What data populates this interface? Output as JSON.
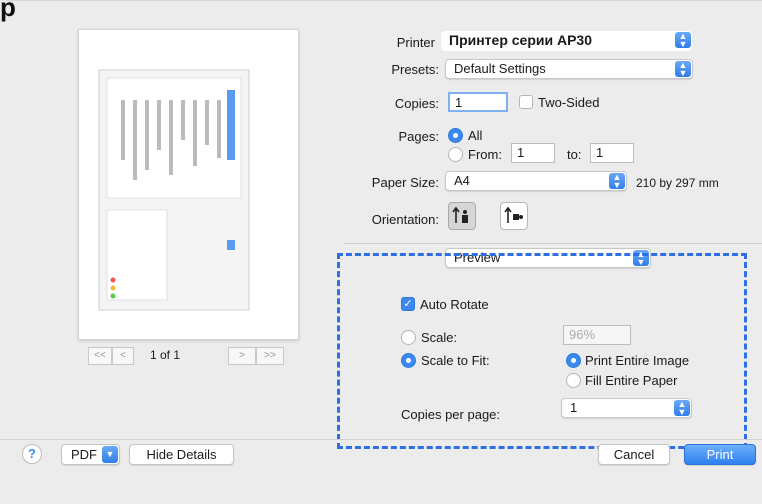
{
  "corner_glyph": "p",
  "printer": {
    "label": "Printer",
    "value": "Принтер серии AP30"
  },
  "presets": {
    "label": "Presets:",
    "value": "Default Settings"
  },
  "copies": {
    "label": "Copies:",
    "value": "1",
    "two_sided_label": "Two-Sided",
    "two_sided_checked": false
  },
  "pages": {
    "label": "Pages:",
    "all_label": "All",
    "from_label": "From:",
    "from_value": "1",
    "to_label": "to:",
    "to_value": "1",
    "selected": "All"
  },
  "paper_size": {
    "label": "Paper Size:",
    "value": "A4",
    "dimensions": "210 by 297 mm"
  },
  "orientation": {
    "label": "Orientation:",
    "selected": "portrait",
    "icons": [
      "portrait-orientation-icon",
      "landscape-orientation-icon"
    ]
  },
  "section_popup": {
    "value": "Preview"
  },
  "preview_options": {
    "auto_rotate_label": "Auto Rotate",
    "auto_rotate_checked": true,
    "scale_label": "Scale:",
    "scale_value": "96%",
    "scale_to_fit_label": "Scale to Fit:",
    "fit_mode": "Scale to Fit",
    "print_entire_image_label": "Print Entire Image",
    "fill_entire_paper_label": "Fill Entire Paper",
    "fit_option": "Print Entire Image",
    "copies_per_page_label": "Copies per page:",
    "copies_per_page_value": "1"
  },
  "preview_nav": {
    "first": "<<",
    "prev": "<",
    "page_indicator": "1 of 1",
    "next": ">",
    "last": ">>"
  },
  "footer": {
    "help": "?",
    "pdf_label": "PDF",
    "hide_details_label": "Hide Details",
    "cancel_label": "Cancel",
    "print_label": "Print"
  },
  "colors": {
    "accent": "#3b89ee",
    "dash": "#2f6fe6",
    "sheet_bg": "#ececec"
  }
}
